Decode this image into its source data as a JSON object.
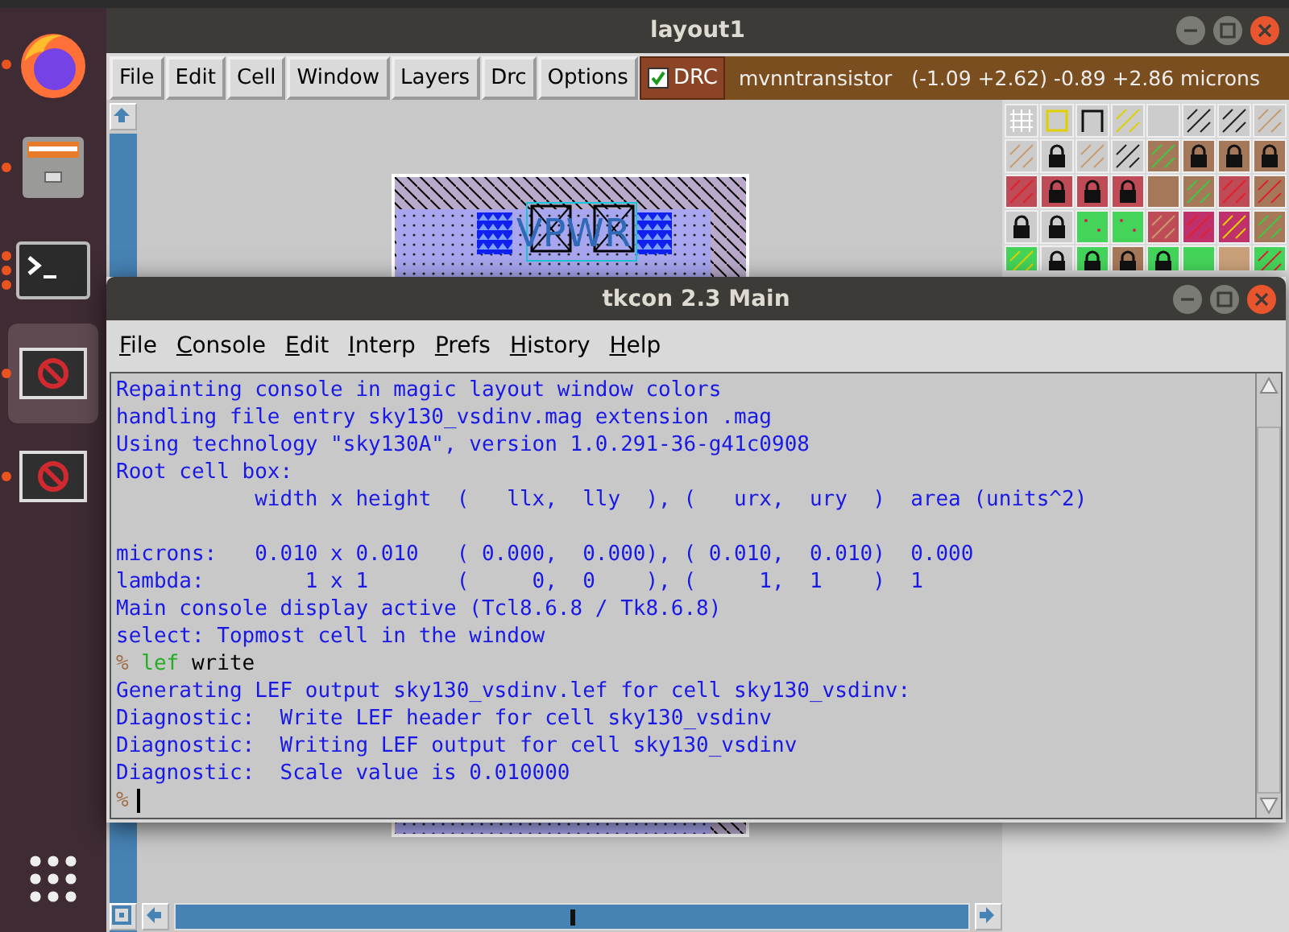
{
  "dock": {
    "apps": [
      {
        "kind": "browser",
        "selected": false,
        "multiple_windows": false
      },
      {
        "kind": "files",
        "selected": false,
        "multiple_windows": false
      },
      {
        "kind": "terminal",
        "selected": false,
        "multiple_windows": true
      },
      {
        "kind": "blocked",
        "selected": true,
        "multiple_windows": false
      },
      {
        "kind": "blocked",
        "selected": false,
        "multiple_windows": false
      }
    ]
  },
  "layout_window": {
    "title": "layout1",
    "menu": [
      "File",
      "Edit",
      "Cell",
      "Window",
      "Layers",
      "Drc",
      "Options"
    ],
    "drc": {
      "label": "DRC",
      "checked": true
    },
    "status": "mvnntransistor   (-1.09 +2.62) -0.89 +2.86 microns",
    "cell_label": "VPWR"
  },
  "console_window": {
    "title": "tkcon 2.3 Main",
    "menu": [
      "File",
      "Console",
      "Edit",
      "Interp",
      "Prefs",
      "History",
      "Help"
    ],
    "lines": [
      {
        "kind": "output",
        "text": "Repainting console in magic layout window colors"
      },
      {
        "kind": "output",
        "text": "handling file entry sky130_vsdinv.mag extension .mag"
      },
      {
        "kind": "output",
        "text": "Using technology \"sky130A\", version 1.0.291-36-g41c0908"
      },
      {
        "kind": "output",
        "text": "Root cell box:"
      },
      {
        "kind": "output",
        "text": "           width x height  (   llx,  lly  ), (   urx,  ury  )  area (units^2)"
      },
      {
        "kind": "blank"
      },
      {
        "kind": "output",
        "text": "microns:   0.010 x 0.010   ( 0.000,  0.000), ( 0.010,  0.010)  0.000"
      },
      {
        "kind": "output",
        "text": "lambda:        1 x 1       (     0,  0    ), (     1,  1    )  1"
      },
      {
        "kind": "output",
        "text": "Main console display active (Tcl8.6.8 / Tk8.6.8)"
      },
      {
        "kind": "output",
        "text": "select: Topmost cell in the window"
      },
      {
        "kind": "command",
        "prompt": "%",
        "command": "lef",
        "args": "write"
      },
      {
        "kind": "output",
        "text": "Generating LEF output sky130_vsdinv.lef for cell sky130_vsdinv:"
      },
      {
        "kind": "output",
        "text": "Diagnostic:  Write LEF header for cell sky130_vsdinv"
      },
      {
        "kind": "output",
        "text": "Diagnostic:  Writing LEF output for cell sky130_vsdinv"
      },
      {
        "kind": "output",
        "text": "Diagnostic:  Scale value is 0.010000"
      },
      {
        "kind": "prompt",
        "prompt": "%"
      }
    ]
  }
}
